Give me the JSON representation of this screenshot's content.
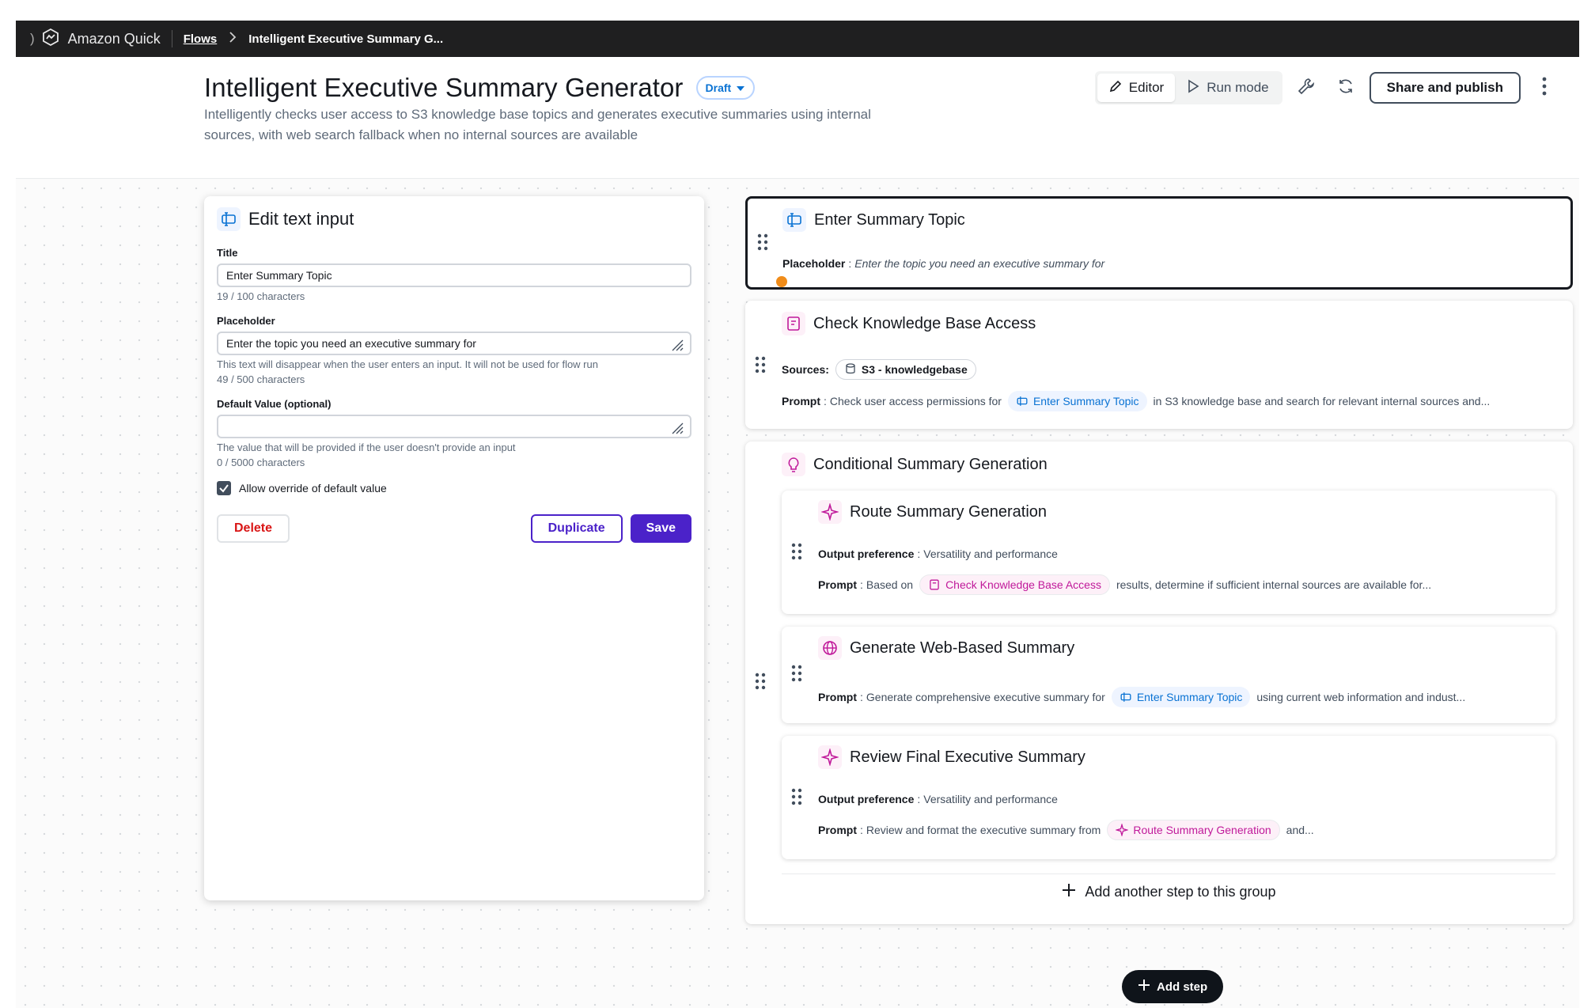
{
  "topbar": {
    "brand": "Amazon Quick",
    "breadcrumb_flows": "Flows",
    "breadcrumb_current": "Intelligent Executive Summary G..."
  },
  "header": {
    "title": "Intelligent Executive Summary Generator",
    "status": "Draft",
    "description": "Intelligently checks user access to S3 knowledge base topics and generates executive summaries using internal sources, with web search fallback when no internal sources are available",
    "editor_label": "Editor",
    "run_mode_label": "Run mode",
    "share_label": "Share and publish"
  },
  "edit_panel": {
    "heading": "Edit text input",
    "title_label": "Title",
    "title_value": "Enter Summary Topic",
    "title_count": "19 / 100 characters",
    "placeholder_label": "Placeholder",
    "placeholder_value": "Enter the topic you need an executive summary for",
    "placeholder_hint": "This text will disappear when the user enters an input. It will not be used for flow run",
    "placeholder_count": "49 / 500 characters",
    "default_label": "Default Value (optional)",
    "default_value": "",
    "default_hint": "The value that will be provided if the user doesn't provide an input",
    "default_count": "0 / 5000 characters",
    "override_label": "Allow override of default value",
    "delete_label": "Delete",
    "duplicate_label": "Duplicate",
    "save_label": "Save"
  },
  "steps": {
    "input": {
      "title": "Enter Summary Topic",
      "placeholder_label": "Placeholder",
      "placeholder_text": "Enter the topic you need an executive summary for"
    },
    "kb": {
      "title": "Check Knowledge Base Access",
      "sources_label": "Sources:",
      "source_tag": "S3 - knowledgebase",
      "prompt_label": "Prompt",
      "prompt_pre": "Check user access permissions for",
      "prompt_tag": "Enter Summary Topic",
      "prompt_post": "in S3 knowledge base and search for relevant internal sources and..."
    },
    "group": {
      "title": "Conditional Summary Generation",
      "route": {
        "title": "Route Summary Generation",
        "output_label": "Output preference",
        "output_value": "Versatility and performance",
        "prompt_label": "Prompt",
        "prompt_pre": "Based on",
        "prompt_tag": "Check Knowledge Base Access",
        "prompt_post": "results, determine if sufficient internal sources are available for..."
      },
      "web": {
        "title": "Generate Web-Based Summary",
        "prompt_label": "Prompt",
        "prompt_pre": "Generate comprehensive executive summary for",
        "prompt_tag": "Enter Summary Topic",
        "prompt_post": "using current web information and indust..."
      },
      "review": {
        "title": "Review Final Executive Summary",
        "output_label": "Output preference",
        "output_value": "Versatility and performance",
        "prompt_label": "Prompt",
        "prompt_pre": "Review and format the executive summary from",
        "prompt_tag": "Route Summary Generation",
        "prompt_post": "and..."
      },
      "add_step_label": "Add another step to this group"
    }
  },
  "add_step_label": "Add step",
  "colors": {
    "accent": "#4b22c9",
    "link_blue": "#0972d3",
    "magenta": "#c0199a",
    "topbar": "#1f1f20",
    "cursor_dot": "#f08c1a"
  },
  "icons": [
    "amazon-quick-logo-icon",
    "chevron-right-icon",
    "caret-down-icon",
    "pencil-icon",
    "play-icon",
    "wrench-icon",
    "refresh-icon",
    "more-vertical-icon",
    "text-input-icon",
    "knowledge-base-icon",
    "database-icon",
    "lightbulb-icon",
    "sparkle-icon",
    "globe-icon",
    "drag-handle-icon",
    "plus-icon",
    "checkmark-icon",
    "resize-handle-icon"
  ]
}
